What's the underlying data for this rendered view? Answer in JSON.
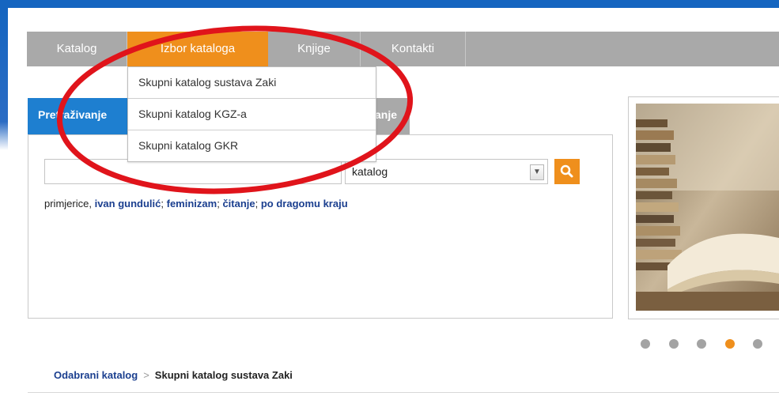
{
  "nav": {
    "items": [
      {
        "label": "Katalog"
      },
      {
        "label": "Izbor kataloga"
      },
      {
        "label": "Knjige"
      },
      {
        "label": "Kontakti"
      }
    ]
  },
  "dropdown": {
    "items": [
      {
        "label": "Skupni katalog sustava Zaki"
      },
      {
        "label": "Skupni katalog KGZ-a"
      },
      {
        "label": "Skupni katalog GKR"
      }
    ]
  },
  "tabs": {
    "active_label": "Pretraživanje",
    "inactive_label": "anje"
  },
  "search": {
    "query": "",
    "select_value": "katalog",
    "examples_prefix": "primjerice,",
    "examples": [
      "ivan gundulić",
      "feminizam",
      "čitanje",
      "po dragomu kraju"
    ]
  },
  "breadcrumb": {
    "link": "Odabrani katalog",
    "separator": ">",
    "current": "Skupni katalog sustava Zaki"
  },
  "carousel": {
    "count": 5,
    "active_index": 3
  },
  "icons": {
    "search": "search-icon",
    "select_arrow": "chevron-down-icon"
  },
  "colors": {
    "accent": "#ef8f1c",
    "nav_bg": "#a9a9a9",
    "tab_blue": "#1e7fd0",
    "link": "#1b3f8f",
    "annotation": "#e0141b"
  }
}
